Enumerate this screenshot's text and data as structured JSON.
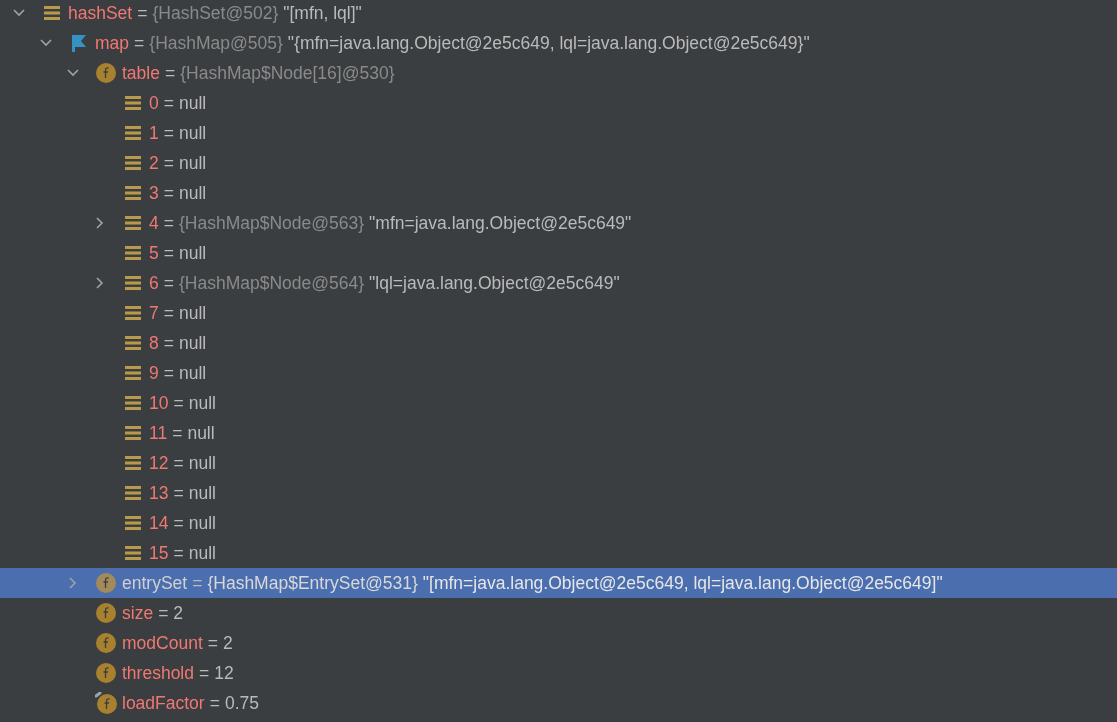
{
  "tree": [
    {
      "name": "hashSet",
      "sep": "=",
      "type": "{HashSet@502}",
      "value": "\"[mfn, lql]\"",
      "kind": "array",
      "expanded": true,
      "selected": false,
      "children": [
        {
          "name": "map",
          "sep": "=",
          "type": "{HashMap@505}",
          "value": "\"{mfn=java.lang.Object@2e5c649, lql=java.lang.Object@2e5c649}\"",
          "kind": "flag",
          "expanded": true,
          "selected": false,
          "children": [
            {
              "name": "table",
              "sep": "=",
              "type": "{HashMap$Node[16]@530}",
              "kind": "field",
              "expanded": true,
              "selected": false,
              "children": [
                {
                  "name": "0",
                  "sep": "=",
                  "value": "null",
                  "kind": "array",
                  "selected": false
                },
                {
                  "name": "1",
                  "sep": "=",
                  "value": "null",
                  "kind": "array",
                  "selected": false
                },
                {
                  "name": "2",
                  "sep": "=",
                  "value": "null",
                  "kind": "array",
                  "selected": false
                },
                {
                  "name": "3",
                  "sep": "=",
                  "value": "null",
                  "kind": "array",
                  "selected": false
                },
                {
                  "name": "4",
                  "sep": "=",
                  "type": "{HashMap$Node@563}",
                  "value": "\"mfn=java.lang.Object@2e5c649\"",
                  "kind": "array",
                  "expanded": false,
                  "selected": false
                },
                {
                  "name": "5",
                  "sep": "=",
                  "value": "null",
                  "kind": "array",
                  "selected": false
                },
                {
                  "name": "6",
                  "sep": "=",
                  "type": "{HashMap$Node@564}",
                  "value": "\"lql=java.lang.Object@2e5c649\"",
                  "kind": "array",
                  "expanded": false,
                  "selected": false
                },
                {
                  "name": "7",
                  "sep": "=",
                  "value": "null",
                  "kind": "array",
                  "selected": false
                },
                {
                  "name": "8",
                  "sep": "=",
                  "value": "null",
                  "kind": "array",
                  "selected": false
                },
                {
                  "name": "9",
                  "sep": "=",
                  "value": "null",
                  "kind": "array",
                  "selected": false
                },
                {
                  "name": "10",
                  "sep": "=",
                  "value": "null",
                  "kind": "array",
                  "selected": false
                },
                {
                  "name": "11",
                  "sep": "=",
                  "value": "null",
                  "kind": "array",
                  "selected": false
                },
                {
                  "name": "12",
                  "sep": "=",
                  "value": "null",
                  "kind": "array",
                  "selected": false
                },
                {
                  "name": "13",
                  "sep": "=",
                  "value": "null",
                  "kind": "array",
                  "selected": false
                },
                {
                  "name": "14",
                  "sep": "=",
                  "value": "null",
                  "kind": "array",
                  "selected": false
                },
                {
                  "name": "15",
                  "sep": "=",
                  "value": "null",
                  "kind": "array",
                  "selected": false
                }
              ]
            },
            {
              "name": "entrySet",
              "sep": "=",
              "type": "{HashMap$EntrySet@531}",
              "value": "\"[mfn=java.lang.Object@2e5c649, lql=java.lang.Object@2e5c649]\"",
              "kind": "field",
              "expanded": false,
              "selected": true
            },
            {
              "name": "size",
              "sep": "=",
              "value": "2",
              "kind": "field",
              "selected": false
            },
            {
              "name": "modCount",
              "sep": "=",
              "value": "2",
              "kind": "field",
              "selected": false
            },
            {
              "name": "threshold",
              "sep": "=",
              "value": "12",
              "kind": "field",
              "selected": false
            },
            {
              "name": "loadFactor",
              "sep": "=",
              "value": "0.75",
              "kind": "final-field",
              "selected": false
            }
          ]
        }
      ]
    }
  ]
}
